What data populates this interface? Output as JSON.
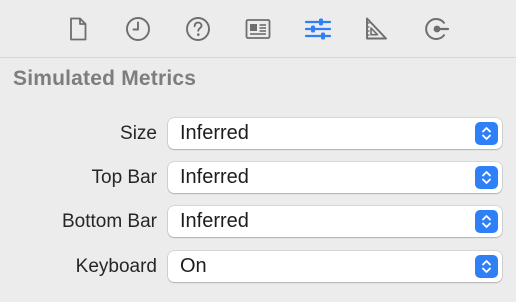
{
  "toolbar": {
    "icons": [
      {
        "name": "file-icon"
      },
      {
        "name": "history-icon"
      },
      {
        "name": "help-icon"
      },
      {
        "name": "identity-card-icon"
      },
      {
        "name": "attributes-sliders-icon",
        "selected": true
      },
      {
        "name": "ruler-triangle-icon"
      },
      {
        "name": "connections-icon"
      }
    ],
    "accent_color": "#2f7ff6"
  },
  "section": {
    "title": "Simulated Metrics"
  },
  "rows": [
    {
      "label": "Size",
      "value": "Inferred"
    },
    {
      "label": "Top Bar",
      "value": "Inferred"
    },
    {
      "label": "Bottom Bar",
      "value": "Inferred"
    },
    {
      "label": "Keyboard",
      "value": "On"
    }
  ]
}
